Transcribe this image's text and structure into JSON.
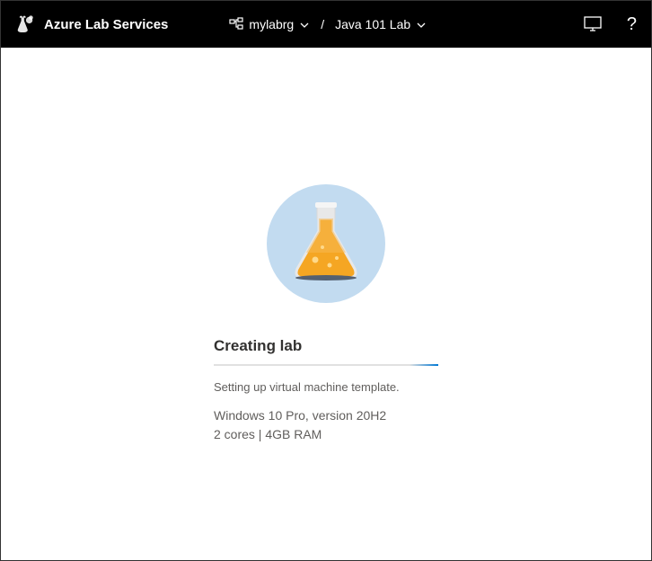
{
  "header": {
    "app_title": "Azure Lab Services",
    "breadcrumb": {
      "resource_group": "mylabrg",
      "separator": "/",
      "lab_name": "Java 101 Lab"
    }
  },
  "status": {
    "title": "Creating lab",
    "message": "Setting up virtual machine template.",
    "os_spec": "Windows 10 Pro, version 20H2",
    "hw_spec": "2 cores | 4GB RAM"
  }
}
